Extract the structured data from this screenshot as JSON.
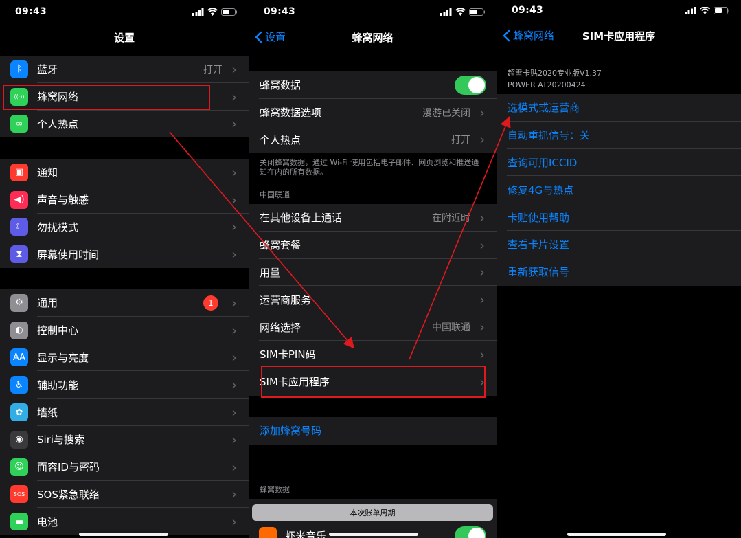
{
  "status": {
    "time": "09:43"
  },
  "screen1": {
    "title": "设置",
    "group1": [
      {
        "label": "蓝牙",
        "value": "打开",
        "icon": "bluetooth-icon",
        "color": "#0a84ff",
        "glyph": "ᛒ"
      },
      {
        "label": "蜂窝网络",
        "value": "",
        "icon": "cellular-antenna-icon",
        "color": "#30d158",
        "glyph": "((·))"
      },
      {
        "label": "个人热点",
        "value": "",
        "icon": "hotspot-link-icon",
        "color": "#30d158",
        "glyph": "∞"
      }
    ],
    "group2": [
      {
        "label": "通知",
        "icon": "notifications-icon",
        "color": "#ff3b30",
        "glyph": "▣"
      },
      {
        "label": "声音与触感",
        "icon": "speaker-icon",
        "color": "#ff2d55",
        "glyph": "◀)"
      },
      {
        "label": "勿扰模式",
        "icon": "moon-icon",
        "color": "#5e5ce6",
        "glyph": "☾"
      },
      {
        "label": "屏幕使用时间",
        "icon": "hourglass-icon",
        "color": "#5e5ce6",
        "glyph": "⧗"
      }
    ],
    "group3": [
      {
        "label": "通用",
        "icon": "gear-icon",
        "color": "#8e8e93",
        "glyph": "⚙",
        "badge": "1"
      },
      {
        "label": "控制中心",
        "icon": "toggles-icon",
        "color": "#8e8e93",
        "glyph": "◐"
      },
      {
        "label": "显示与亮度",
        "icon": "display-aa-icon",
        "color": "#0a84ff",
        "glyph": "AA"
      },
      {
        "label": "辅助功能",
        "icon": "accessibility-icon",
        "color": "#0a84ff",
        "glyph": "♿"
      },
      {
        "label": "墙纸",
        "icon": "wallpaper-flower-icon",
        "color": "#32ade6",
        "glyph": "✿"
      },
      {
        "label": "Siri与搜索",
        "icon": "siri-icon",
        "color": "#3a3a3c",
        "glyph": "◉"
      },
      {
        "label": "面容ID与密码",
        "icon": "face-id-icon",
        "color": "#30d158",
        "glyph": "☺"
      },
      {
        "label": "SOS紧急联络",
        "icon": "sos-icon",
        "color": "#ff3b30",
        "glyph": "SOS"
      },
      {
        "label": "电池",
        "icon": "battery-icon",
        "color": "#30d158",
        "glyph": "▬"
      }
    ]
  },
  "screen2": {
    "back": "设置",
    "title": "蜂窝网络",
    "group1": [
      {
        "label": "蜂窝数据",
        "value": "",
        "toggle": true
      },
      {
        "label": "蜂窝数据选项",
        "value": "漫游已关闭"
      },
      {
        "label": "个人热点",
        "value": "打开"
      }
    ],
    "note": "关闭蜂窝数据，通过 Wi-Fi 使用包括电子邮件、网页浏览和推送通知在内的所有数据。",
    "carrier_header": "中国联通",
    "group2": [
      {
        "label": "在其他设备上通话",
        "value": "在附近时"
      },
      {
        "label": "蜂窝套餐",
        "value": ""
      },
      {
        "label": "用量",
        "value": ""
      },
      {
        "label": "运营商服务",
        "value": ""
      },
      {
        "label": "网络选择",
        "value": "中国联通"
      },
      {
        "label": "SIM卡PIN码",
        "value": ""
      },
      {
        "label": "SIM卡应用程序",
        "value": ""
      }
    ],
    "add_plan": "添加蜂窝号码",
    "data_header": "蜂窝数据",
    "period_button": "本次账单周期",
    "partial_item": "虾米音乐"
  },
  "screen3": {
    "back": "蜂窝网络",
    "title": "SIM卡应用程序",
    "info_line1": "超雪卡贴2020专业版V1.37",
    "info_line2": "POWER AT20200424",
    "items": [
      "选模式或运营商",
      "自动重抓信号：关",
      "查询可用ICCID",
      "修复4G与热点",
      "卡贴使用帮助",
      "查看卡片设置",
      "重新获取信号"
    ]
  },
  "colors": {
    "accent": "#0a84ff",
    "annotation": "#e0191f",
    "toggle_on": "#34c759"
  }
}
